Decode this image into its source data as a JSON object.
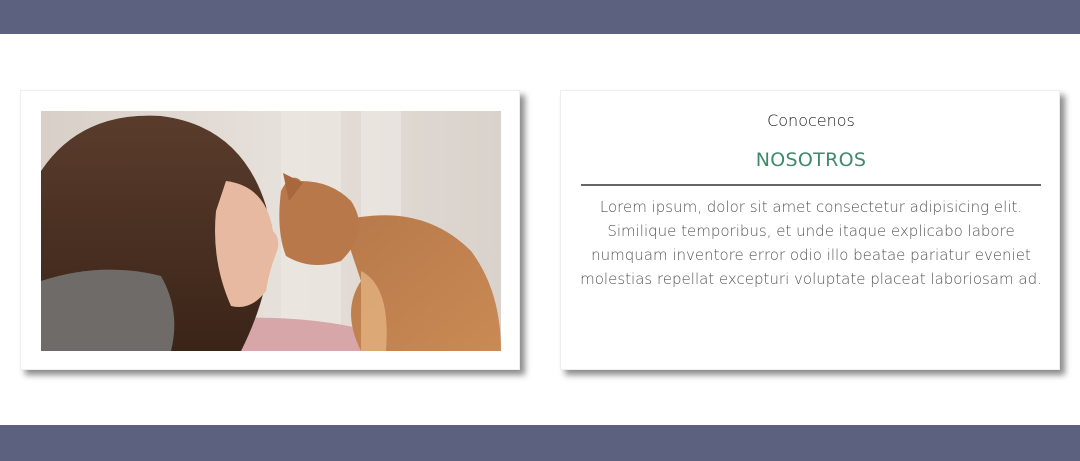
{
  "theme": {
    "bar_color": "#5d6180",
    "accent_green": "#3f8a6a"
  },
  "about": {
    "eyebrow": "Conocenos",
    "heading": "NOSOTROS",
    "body": "Lorem ipsum, dolor sit amet consectetur adipisicing elit. Similique temporibus, et unde itaque explicabo labore numquam inventore error odio illo beatae pariatur eveniet molestias repellat excepturi voluptate placeat laboriosam ad."
  },
  "photo": {
    "subject": "woman-touching-noses-with-cat"
  }
}
